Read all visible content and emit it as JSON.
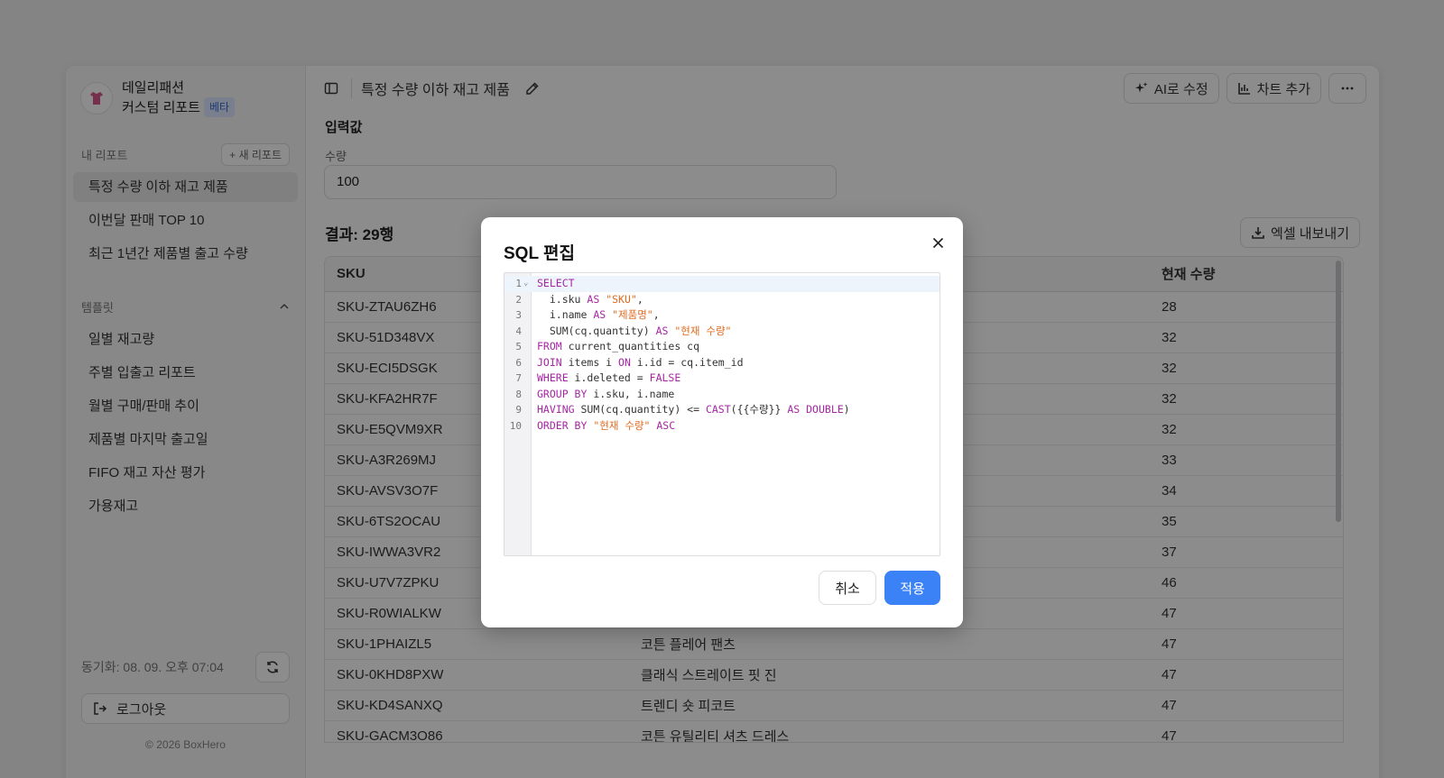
{
  "sidebar": {
    "brand_line1": "데일리패션",
    "brand_line2": "커스텀 리포트",
    "beta_badge": "베타",
    "my_reports_label": "내 리포트",
    "new_report_button": "+ 새 리포트",
    "reports": [
      "특정 수량 이하 재고 제품",
      "이번달 판매 TOP 10",
      "최근 1년간 제품별 출고 수량"
    ],
    "templates_label": "템플릿",
    "templates": [
      "일별 재고량",
      "주별 입출고 리포트",
      "월별 구매/판매 추이",
      "제품별 마지막 출고일",
      "FIFO 재고 자산 평가",
      "가용재고"
    ],
    "sync_text": "동기화: 08. 09. 오후 07:04",
    "logout_label": "로그아웃",
    "copyright": "© 2026 BoxHero"
  },
  "topbar": {
    "report_title": "특정 수량 이하 재고 제품",
    "ai_edit_label": "AI로 수정",
    "add_chart_label": "차트 추가"
  },
  "inputs": {
    "section_title": "입력값",
    "quantity_label": "수량",
    "quantity_value": "100"
  },
  "results": {
    "title": "결과: 29행",
    "export_label": "엑셀 내보내기",
    "columns": [
      "SKU",
      "",
      "현재 수량"
    ],
    "rows": [
      [
        "SKU-ZTAU6ZH6",
        "",
        "28"
      ],
      [
        "SKU-51D348VX",
        "",
        "32"
      ],
      [
        "SKU-ECI5DSGK",
        "",
        "32"
      ],
      [
        "SKU-KFA2HR7F",
        "",
        "32"
      ],
      [
        "SKU-E5QVM9XR",
        "",
        "32"
      ],
      [
        "SKU-A3R269MJ",
        "",
        "33"
      ],
      [
        "SKU-AVSV3O7F",
        "",
        "34"
      ],
      [
        "SKU-6TS2OCAU",
        "",
        "35"
      ],
      [
        "SKU-IWWA3VR2",
        "",
        "37"
      ],
      [
        "SKU-U7V7ZPKU",
        "",
        "46"
      ],
      [
        "SKU-R0WIALKW",
        "",
        "47"
      ],
      [
        "SKU-1PHAIZL5",
        "코튼 플레어 팬츠",
        "47"
      ],
      [
        "SKU-0KHD8PXW",
        "클래식 스트레이트 핏 진",
        "47"
      ],
      [
        "SKU-KD4SANXQ",
        "트렌디 숏 피코트",
        "47"
      ],
      [
        "SKU-GACM3O86",
        "코튼 유틸리티 셔츠 드레스",
        "47"
      ]
    ]
  },
  "modal": {
    "title": "SQL 편집",
    "cancel_label": "취소",
    "apply_label": "적용",
    "code_lines": [
      [
        [
          "kw",
          "SELECT"
        ]
      ],
      [
        [
          "t",
          "  i.sku "
        ],
        [
          "kw",
          "AS"
        ],
        [
          "t",
          " "
        ],
        [
          "str",
          "\"SKU\""
        ],
        [
          "t",
          ","
        ]
      ],
      [
        [
          "t",
          "  i.name "
        ],
        [
          "kw",
          "AS"
        ],
        [
          "t",
          " "
        ],
        [
          "str",
          "\"제품명\""
        ],
        [
          "t",
          ","
        ]
      ],
      [
        [
          "t",
          "  SUM(cq.quantity) "
        ],
        [
          "kw",
          "AS"
        ],
        [
          "t",
          " "
        ],
        [
          "str",
          "\"현재 수량\""
        ]
      ],
      [
        [
          "kw",
          "FROM"
        ],
        [
          "t",
          " current_quantities cq"
        ]
      ],
      [
        [
          "kw",
          "JOIN"
        ],
        [
          "t",
          " items i "
        ],
        [
          "kw",
          "ON"
        ],
        [
          "t",
          " i.id = cq.item_id"
        ]
      ],
      [
        [
          "kw",
          "WHERE"
        ],
        [
          "t",
          " i.deleted = "
        ],
        [
          "kw",
          "FALSE"
        ]
      ],
      [
        [
          "kw",
          "GROUP BY"
        ],
        [
          "t",
          " i.sku, i.name"
        ]
      ],
      [
        [
          "kw",
          "HAVING"
        ],
        [
          "t",
          " SUM(cq.quantity) <= "
        ],
        [
          "kw",
          "CAST"
        ],
        [
          "t",
          "({{수량}} "
        ],
        [
          "kw",
          "AS DOUBLE"
        ],
        [
          "t",
          ")"
        ]
      ],
      [
        [
          "kw",
          "ORDER BY"
        ],
        [
          "t",
          " "
        ],
        [
          "str",
          "\"현재 수량\""
        ],
        [
          "t",
          " "
        ],
        [
          "kw",
          "ASC"
        ]
      ]
    ]
  }
}
